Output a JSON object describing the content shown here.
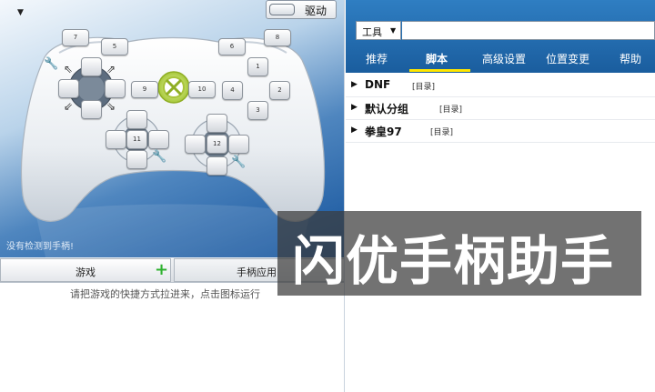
{
  "toolbar": {
    "drive_label": "驱动"
  },
  "controller": {
    "buttons": {
      "b1": "1",
      "b2": "2",
      "b3": "3",
      "b4": "4",
      "b5": "5",
      "b6": "6",
      "b7": "7",
      "b8": "8",
      "b9": "9",
      "b10": "10",
      "b11": "11",
      "b12": "12"
    }
  },
  "status": {
    "no_controller": "没有检测到手柄!"
  },
  "left_tabs": {
    "games": "游戏",
    "pad_apps": "手柄应用"
  },
  "hint": "请把游戏的快捷方式拉进来，点击图标运行",
  "right": {
    "tool_select": "工具",
    "nav": [
      {
        "label": "推荐"
      },
      {
        "label": "脚本"
      },
      {
        "label": "高级设置"
      },
      {
        "label": "位置变更"
      },
      {
        "label": "帮助"
      }
    ],
    "active_nav": "脚本",
    "scripts": [
      {
        "name": "DNF",
        "dir": "[目录]"
      },
      {
        "name": "默认分组",
        "dir": "[目录]"
      },
      {
        "name": "拳皇97",
        "dir": "[目录]"
      }
    ]
  },
  "banner": {
    "text": "闪优手柄助手"
  },
  "icons": [
    "collapse-arrow-icon",
    "wrench-icon",
    "xbox-logo-icon",
    "plus-icon",
    "dropdown-caret-icon",
    "expand-triangle-icon"
  ],
  "colors": {
    "header_blue": "#1f66a8",
    "active_underline": "#ffe600",
    "add_green": "#2fb12f"
  }
}
